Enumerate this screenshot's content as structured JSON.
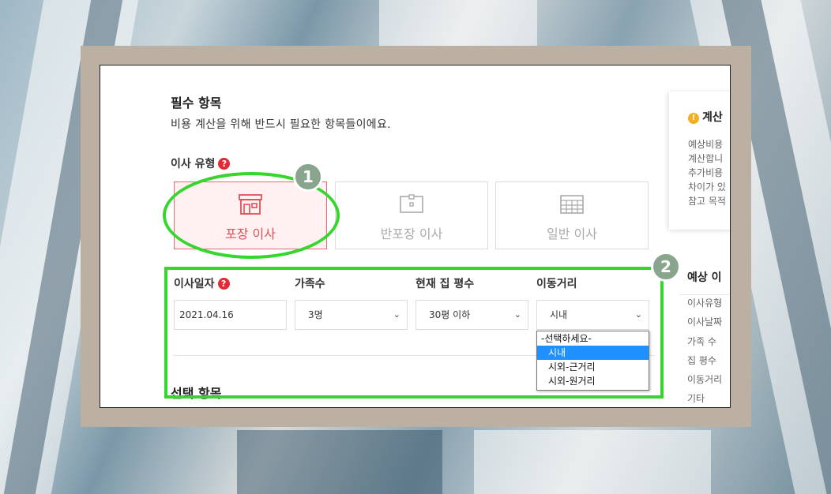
{
  "required": {
    "title": "필수 항목",
    "subtitle": "비용 계산을 위해 반드시 필요한 항목들이에요.",
    "move_type_label": "이사 유형",
    "help_mark": "?",
    "move_types": [
      {
        "label": "포장 이사",
        "selected": true,
        "icon": "store-icon"
      },
      {
        "label": "반포장 이사",
        "selected": false,
        "icon": "box-icon"
      },
      {
        "label": "일반 이사",
        "selected": false,
        "icon": "truck-grid-icon"
      }
    ],
    "fields": {
      "date": {
        "label": "이사일자",
        "value": "2021.04.16"
      },
      "family": {
        "label": "가족수",
        "value": "3명"
      },
      "size": {
        "label": "현재 집 평수",
        "value": "30평 이하"
      },
      "distance": {
        "label": "이동거리",
        "value": "시내"
      }
    },
    "distance_options": [
      "-선택하세요-",
      "시내",
      "시외-근거리",
      "시외-원거리"
    ],
    "distance_selected_index": 1
  },
  "optional": {
    "title": "선택 항목"
  },
  "sidebar": {
    "calc_title": "계산",
    "calc_lines": [
      "예상비용",
      "계산합니",
      "추가비용",
      "차이가 있",
      "참고 목적"
    ],
    "estimate_title": "예상 이",
    "estimate_items": [
      "이사유형",
      "이사날짜",
      "가족 수",
      "집 평수",
      "이동거리",
      "기타"
    ]
  },
  "annotations": {
    "badge_1": "1",
    "badge_2": "2",
    "accent_color": "#35d62e"
  },
  "colors": {
    "selected_card_border": "#e36b73",
    "selected_card_bg": "#fff1f1",
    "help_red": "#e02a35",
    "dropdown_highlight": "#1e90ff"
  }
}
